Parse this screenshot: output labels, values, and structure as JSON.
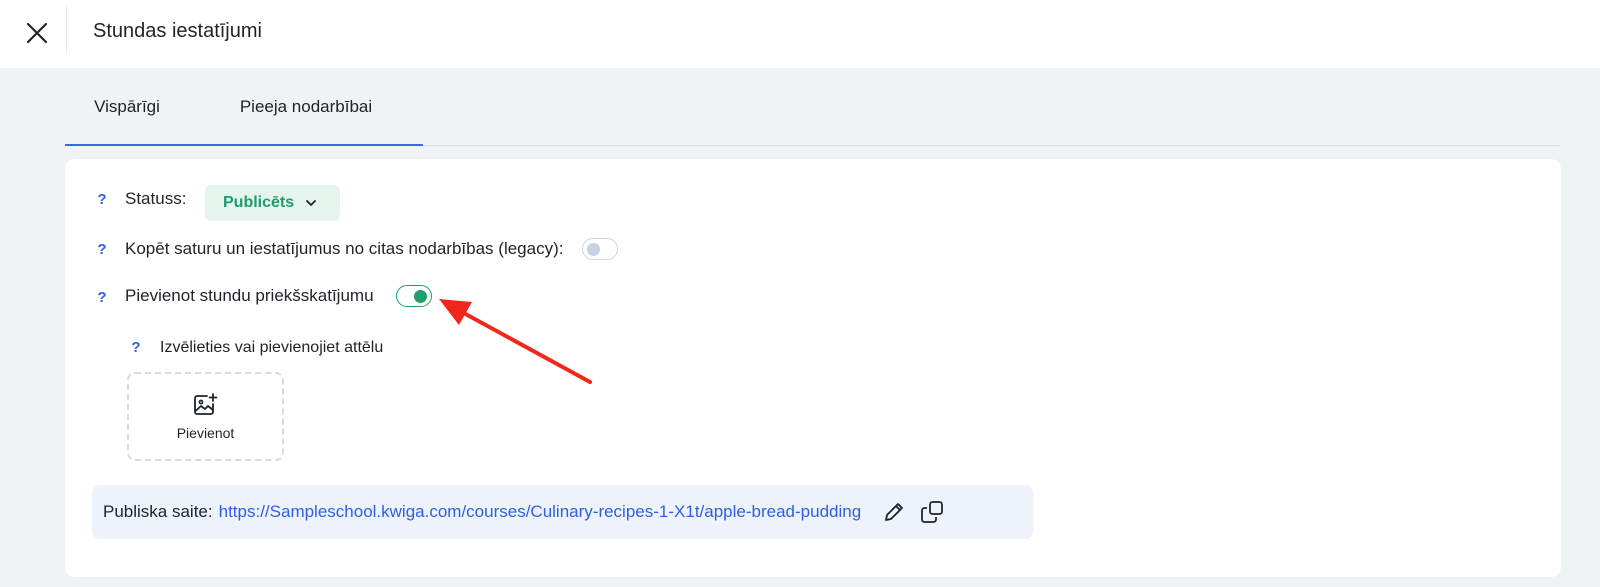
{
  "header": {
    "title": "Stundas iestatījumi",
    "close_icon": "close-icon"
  },
  "tabs": [
    {
      "label": "Vispārīgi"
    },
    {
      "label": "Pieeja nodarbībai"
    }
  ],
  "settings": {
    "help_glyph": "?",
    "status": {
      "label": "Statuss:",
      "value": "Publicēts"
    },
    "copy_content": {
      "label": "Kopēt saturu un iestatījumus no citas nodarbības (legacy):",
      "enabled": false
    },
    "lesson_preview": {
      "label": "Pievienot stundu priekšskatījumu",
      "enabled": true
    },
    "image": {
      "label": "Izvēlieties vai pievienojiet attēlu",
      "add_label": "Pievienot",
      "icon": "add-image-icon"
    },
    "public_link": {
      "label": "Publiska saite:",
      "url": "https://Sampleschool.kwiga.com/courses/Culinary-recipes-1-X1t/apple-bread-pudding",
      "edit_icon": "pencil-icon",
      "copy_icon": "copy-icon"
    }
  },
  "colors": {
    "accent_blue": "#2f5fe0",
    "success_green": "#1f9d6a",
    "annotation_red": "#f0271b"
  }
}
